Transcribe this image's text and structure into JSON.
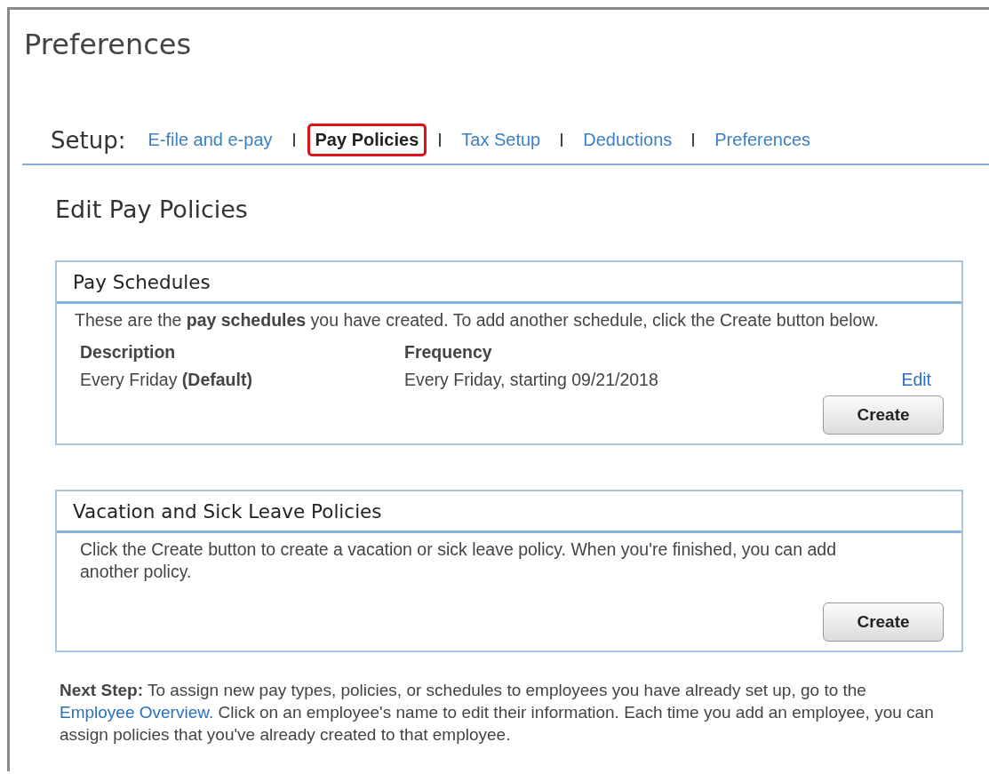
{
  "page_title": "Preferences",
  "setup": {
    "label": "Setup:",
    "tabs": [
      {
        "label": "E-file and e-pay",
        "selected": false
      },
      {
        "label": "Pay Policies",
        "selected": true
      },
      {
        "label": "Tax Setup",
        "selected": false
      },
      {
        "label": "Deductions",
        "selected": false
      },
      {
        "label": "Preferences",
        "selected": false
      }
    ]
  },
  "heading": "Edit Pay Policies",
  "pay_schedules": {
    "title": "Pay Schedules",
    "intro": "These are the **pay schedules** you have created. To add another schedule, click the Create button below.",
    "columns": [
      "Description",
      "Frequency"
    ],
    "rows": [
      {
        "description": "Every Friday **(Default)**",
        "frequency": "Every Friday, starting 09/21/2018",
        "action": "Edit"
      }
    ],
    "button": "Create"
  },
  "leave_policies": {
    "title": "Vacation and Sick Leave Policies",
    "intro": "Click the Create button to create a vacation or sick leave policy. When you're finished, you can add another policy.",
    "button": "Create"
  },
  "next_step": {
    "before": "**Next Step:** To assign new pay types, policies, or schedules to employees you have already set up, go to the",
    "link": "Employee Overview.",
    "after": "Click on an employee's name to edit their information. Each time you add an employee, you can assign policies that you've already created to that employee."
  }
}
